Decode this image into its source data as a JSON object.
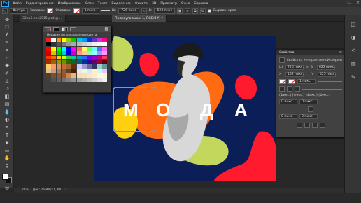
{
  "menu": [
    "Файл",
    "Редактирование",
    "Изображение",
    "Слои",
    "Текст",
    "Выделение",
    "Фильтр",
    "3D",
    "Просмотр",
    "Окно",
    "Справка"
  ],
  "logo_text": "Ps",
  "window_controls": [
    "—",
    "❐",
    "✕"
  ],
  "options": {
    "mode": "Фигура",
    "fill_label": "Заливка:",
    "stroke_label": "Обводка:",
    "stroke_width": "1 пикс.",
    "w_label": "Ш:",
    "w_value": "726 пикс",
    "h_label": "В:",
    "h_value": "623 пикс",
    "align_edges_label": "Выравн. края"
  },
  "tabs": {
    "doc1": "32ab6.ece2015.psd @ ...",
    "doc2": "Прямоугольник 1, RGB/8#) *"
  },
  "artboard_text": [
    "М",
    "О",
    "Д",
    "А"
  ],
  "swatches": {
    "title": "Недавно использованные цвета",
    "colors": [
      "#ff1a1a",
      "#ffffff",
      "#ff9900",
      "#ffff00",
      "#99cc00",
      "#00cc00",
      "#00cccc",
      "#0099ff",
      "#0033cc",
      "#6633cc",
      "#cc33cc",
      "#ff0099",
      "#000000",
      "#333333",
      "#555555",
      "#777777",
      "#999999",
      "#aaaaaa",
      "#bbbbbb",
      "#cccccc",
      "#dddddd",
      "#eeeeee",
      "#f5f5f5",
      "#ffffff",
      "#ff0000",
      "#ffff00",
      "#00ff00",
      "#00ffff",
      "#0000ff",
      "#ff00ff",
      "#ff6666",
      "#ffff66",
      "#66ff66",
      "#66ffff",
      "#6666ff",
      "#ff66ff",
      "#cc0000",
      "#cccc00",
      "#00cc00",
      "#00cccc",
      "#0000cc",
      "#cc00cc",
      "#ff9999",
      "#ffcc99",
      "#99ff99",
      "#99ffff",
      "#9999ff",
      "#ff99ff",
      "#ff3300",
      "#ff6600",
      "#ffcc00",
      "#ccff00",
      "#33cc33",
      "#00cc99",
      "#0099cc",
      "#3366ff",
      "#6600ff",
      "#9900cc",
      "#cc0066",
      "#ff3366",
      "#993300",
      "#996600",
      "#999900",
      "#669900",
      "#336600",
      "#006633",
      "#006666",
      "#003399",
      "#330099",
      "#660066",
      "#990033",
      "#660000",
      "#ffcc66",
      "#ff9966",
      "#cc9966",
      "#cc6633",
      "#996633",
      "#663300",
      "#ccccff",
      "#9999cc",
      "#666699",
      "#333366",
      "#99cccc",
      "#669999",
      "#e0c0a0",
      "#c0a080",
      "#a08060",
      "#806040",
      "#604020",
      "#402000",
      "#ffe0e0",
      "#e0ffe0",
      "#e0e0ff",
      "#fff0c0",
      "#c0fff0",
      "#f0c0ff",
      "#5a3c1e",
      "#7a5030",
      "#8b5a2b",
      "#a0522d",
      "#cd853f",
      "#deb887",
      "#f5deb3",
      "#ffdead",
      "#ffe4c4",
      "#ffebcd",
      "#fff8dc",
      "#fafad2",
      "#404040",
      "#505050",
      "#606060",
      "#707070",
      "#808080",
      "#909090",
      "#a0a0a0",
      "#b0b0b0",
      "#c0c0c0",
      "#d0d0d0",
      "#e0e0e0",
      "#f0f0f0"
    ]
  },
  "properties": {
    "tab": "Свойства",
    "subtitle": "Свойства интерактивной формы",
    "w": "726 пикс.",
    "h": "623 пикс.",
    "x": "152 пикс.",
    "y": "425 пикс.",
    "stroke": "1 пикс.",
    "corner_tl": "0 пикс.",
    "corner_tr": "0 пикс.",
    "corner_bl": "0 пикс.",
    "corner_br": "0 пикс.",
    "link_label": "(Фикс.) (Фикс.) (Фикс.) (Фикс.)"
  },
  "status": {
    "zoom": "27%",
    "doc": "Док: 26,8М/11,3М",
    "arrow": "›"
  }
}
